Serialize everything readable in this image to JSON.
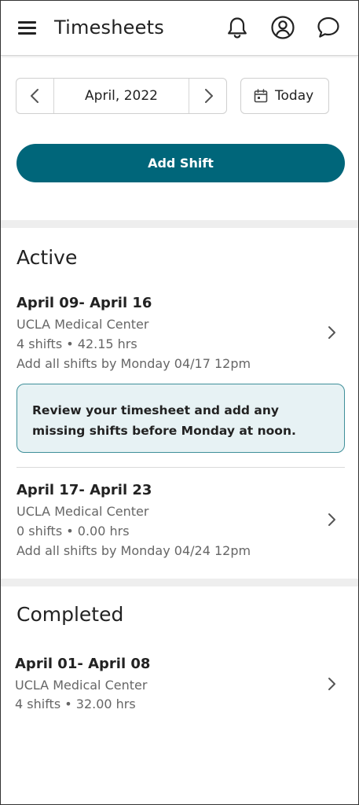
{
  "header": {
    "title": "Timesheets",
    "icons": [
      "menu-icon",
      "bell-icon",
      "account-icon",
      "chat-icon"
    ]
  },
  "period": {
    "label": "April, 2022",
    "today_label": "Today"
  },
  "actions": {
    "add_shift_label": "Add Shift"
  },
  "active": {
    "title": "Active",
    "weeks": [
      {
        "range": "April 09- April 16",
        "location": "UCLA Medical Center",
        "summary": "4 shifts • 42.15 hrs",
        "deadline": "Add all shifts by Monday 04/17 12pm"
      },
      {
        "range": "April 17- April 23",
        "location": "UCLA Medical Center",
        "summary": "0 shifts • 0.00 hrs",
        "deadline": "Add all shifts by Monday 04/24 12pm"
      }
    ],
    "notice": "Review your timesheet and add any missing shifts before Monday at noon."
  },
  "completed": {
    "title": "Completed",
    "weeks": [
      {
        "range": "April 01- April 08",
        "location": "UCLA Medical Center",
        "summary": "4 shifts • 32.00 hrs"
      }
    ]
  },
  "colors": {
    "accent": "#00667a",
    "notice_bg": "#e7f2f4",
    "notice_border": "#3f8f99"
  }
}
